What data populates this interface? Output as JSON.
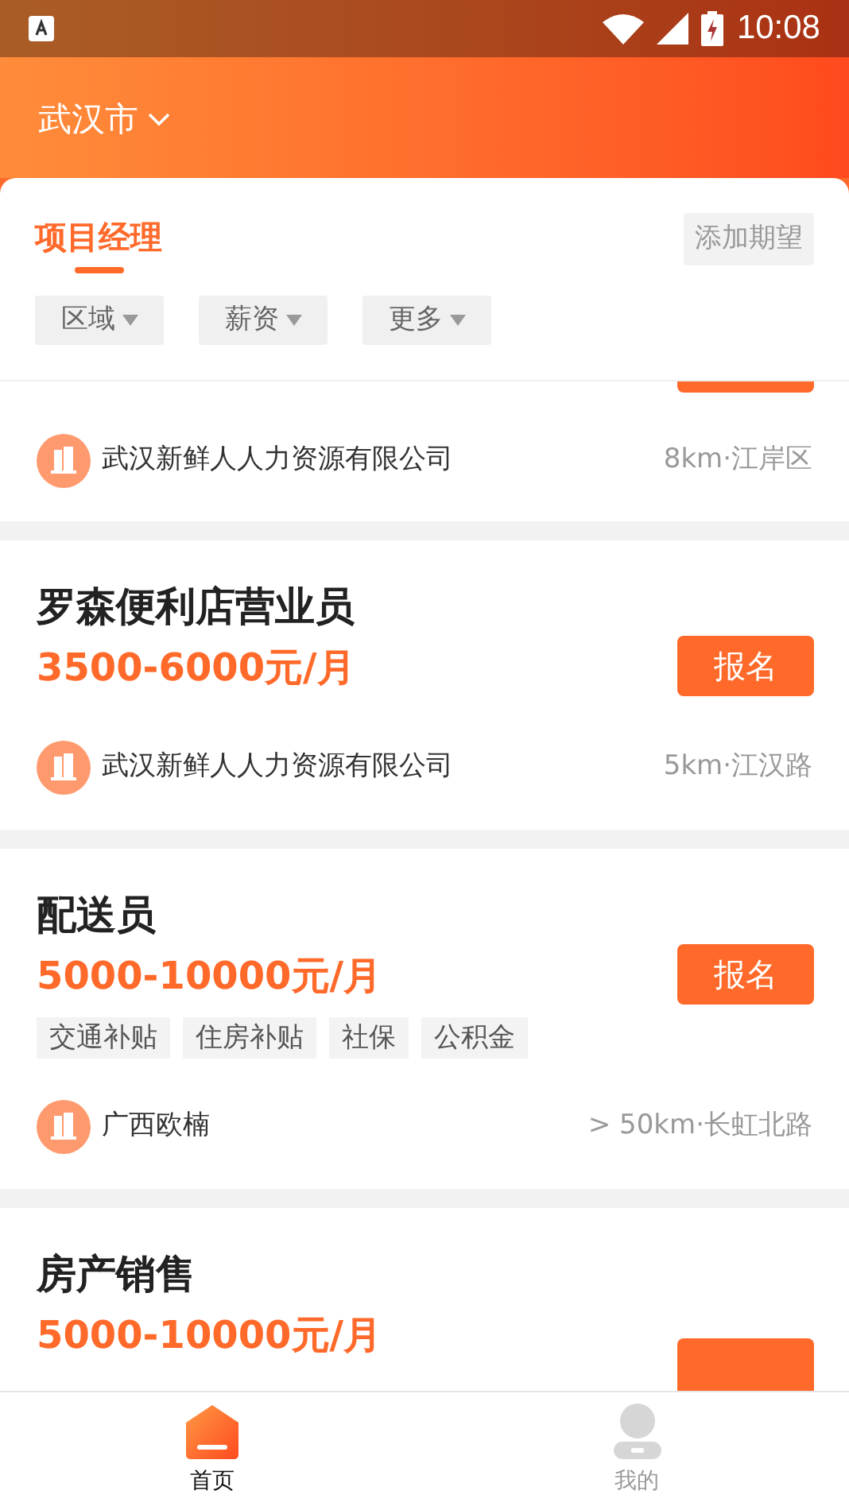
{
  "status_bar": {
    "time": "10:08"
  },
  "header": {
    "city": "武汉市"
  },
  "tabs": [
    {
      "label": "项目经理",
      "selected": true
    }
  ],
  "add_button": "添加期望",
  "filters": [
    "区域",
    "薪资",
    "更多"
  ],
  "jobs": [
    {
      "kind": "partial_top",
      "company": "武汉新鲜人人力资源有限公司",
      "distance": "8km·江岸区"
    },
    {
      "kind": "full",
      "title": "罗森便利店营业员",
      "salary": "3500-6000元/月",
      "button": "报名",
      "company": "武汉新鲜人人力资源有限公司",
      "distance": "5km·江汉路"
    },
    {
      "kind": "full",
      "title": "配送员",
      "salary": "5000-10000元/月",
      "tags": [
        "交通补贴",
        "住房补贴",
        "社保",
        "公积金"
      ],
      "button": "报名",
      "company": "广西欧楠",
      "distance": "> 50km·长虹北路"
    },
    {
      "kind": "partial_bottom",
      "title": "房产销售",
      "salary": "5000-10000元/月"
    }
  ],
  "bottom_nav": [
    {
      "label": "首页",
      "kind": "home",
      "selected": true
    },
    {
      "label": "我的",
      "kind": "profile",
      "selected": false
    }
  ]
}
